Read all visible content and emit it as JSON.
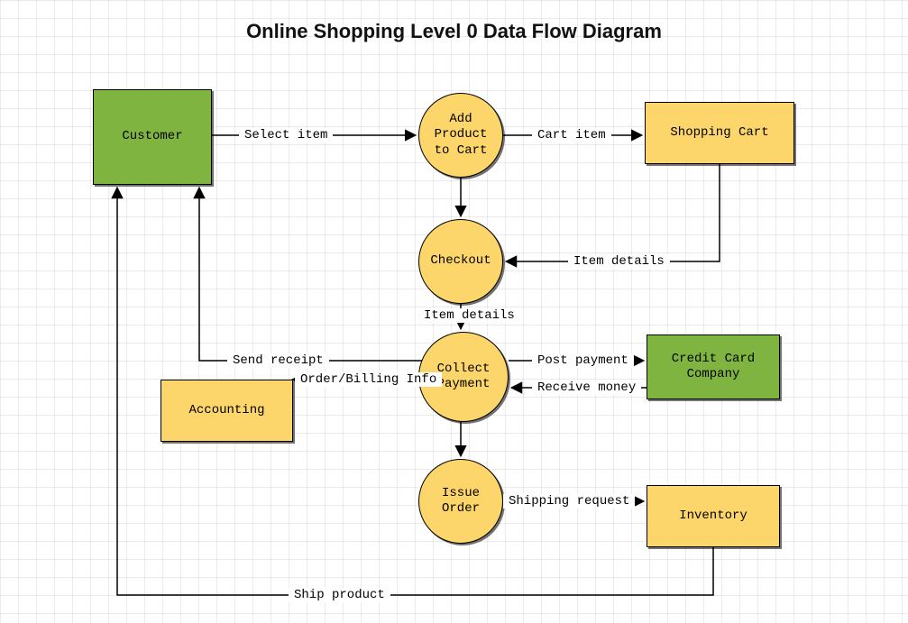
{
  "title": "Online Shopping Level 0 Data Flow Diagram",
  "nodes": {
    "customer": {
      "label": "Customer"
    },
    "addProduct": {
      "label": "Add\nProduct\nto Cart"
    },
    "shoppingCart": {
      "label": "Shopping Cart"
    },
    "checkout": {
      "label": "Checkout"
    },
    "collectPayment": {
      "label": "Collect\nPayment"
    },
    "creditCard": {
      "label": "Credit Card\nCompany"
    },
    "accounting": {
      "label": "Accounting"
    },
    "issueOrder": {
      "label": "Issue\nOrder"
    },
    "inventory": {
      "label": "Inventory"
    }
  },
  "edges": {
    "selectItem": {
      "label": "Select item"
    },
    "cartItem": {
      "label": "Cart item"
    },
    "itemDetails1": {
      "label": "Item details"
    },
    "itemDetails2": {
      "label": "Item details"
    },
    "sendReceipt": {
      "label": "Send receipt"
    },
    "orderBilling": {
      "label": "Order/Billing Info"
    },
    "postPayment": {
      "label": "Post payment"
    },
    "receiveMoney": {
      "label": "Receive money"
    },
    "shippingRequest": {
      "label": "Shipping request"
    },
    "shipProduct": {
      "label": "Ship product"
    }
  },
  "colors": {
    "green": "#80b441",
    "yellow": "#fcd66a"
  }
}
